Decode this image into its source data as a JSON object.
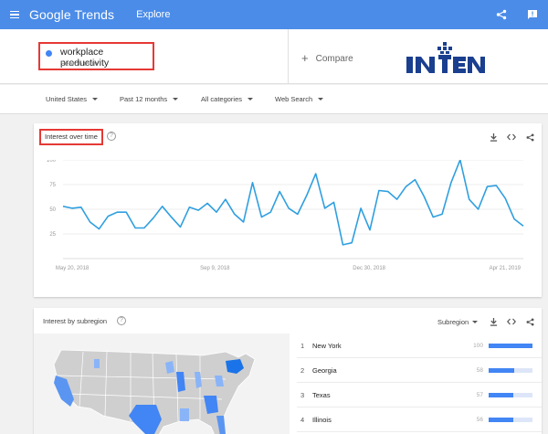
{
  "colors": {
    "topbar": "#4b8ce8",
    "accent": "#4285f4",
    "highlight_border": "#e53935",
    "line": "#2f9fe0"
  },
  "topbar": {
    "menu_icon": "hamburger-icon",
    "brand_google": "Google",
    "brand_trends": "Trends",
    "page": "Explore",
    "icons": [
      "share-icon",
      "feedback-icon"
    ]
  },
  "search": {
    "term": "workplace productivity",
    "term_type": "Search term",
    "compare_label": "Compare",
    "logo_text": "INTEN"
  },
  "filters": {
    "region": "United States",
    "period": "Past 12 months",
    "category": "All categories",
    "search_type": "Web Search"
  },
  "interest_over_time": {
    "title": "Interest over time",
    "help_mark": "?",
    "icons": [
      "download-icon",
      "embed-icon",
      "share-icon"
    ]
  },
  "chart_data": {
    "type": "line",
    "title": "Interest over time",
    "xlabel": "",
    "ylabel": "",
    "ylim": [
      0,
      100
    ],
    "yticks": [
      25,
      50,
      75,
      100
    ],
    "xtick_labels": [
      "May 20, 2018",
      "Sep 9, 2018",
      "Dec 30, 2018",
      "Apr 21, 2019"
    ],
    "grid": true,
    "series": [
      {
        "values": [
          53,
          51,
          52,
          37,
          30,
          43,
          47,
          47,
          31,
          31,
          41,
          53,
          42,
          32,
          52,
          49,
          56,
          47,
          60,
          45,
          37,
          77,
          42,
          47,
          68,
          51,
          45,
          64,
          86,
          51,
          57,
          14,
          16,
          51,
          29,
          69,
          68,
          60,
          73,
          80,
          63,
          42,
          45,
          77,
          100,
          60,
          50,
          73,
          74,
          61,
          40,
          33
        ]
      }
    ]
  },
  "subregion": {
    "title": "Interest by subregion",
    "help_mark": "?",
    "selector": "Subregion",
    "icons": [
      "download-icon",
      "embed-icon",
      "share-icon"
    ],
    "rows": [
      {
        "rank": "1",
        "name": "New York",
        "value": 100
      },
      {
        "rank": "2",
        "name": "Georgia",
        "value": 58
      },
      {
        "rank": "3",
        "name": "Texas",
        "value": 57
      },
      {
        "rank": "4",
        "name": "Illinois",
        "value": 56
      }
    ]
  }
}
